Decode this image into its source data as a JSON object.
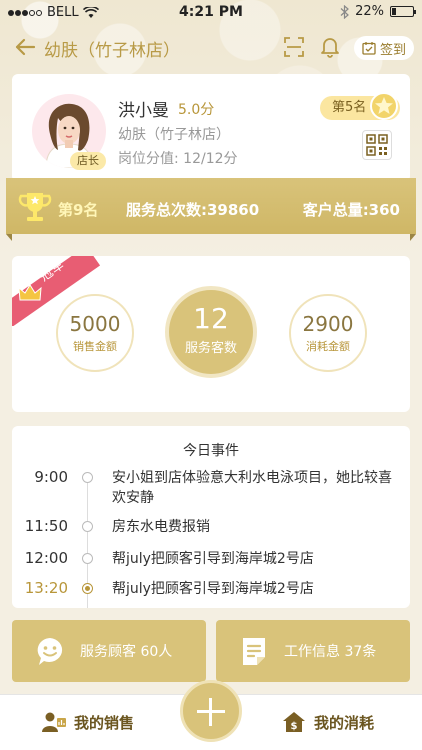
{
  "status_bar": {
    "carrier": "BELL",
    "time": "4:21 PM",
    "battery": "22%"
  },
  "nav": {
    "title": "幼肤（竹子林店）",
    "checkin_label": "签到"
  },
  "profile": {
    "name": "洪小曼",
    "score": "5.0分",
    "store": "幼肤（竹子林店）",
    "position_score": "岗位分值: 12/12分",
    "role": "店长",
    "rank": "第5名"
  },
  "ranking": {
    "rank": "第9名",
    "total_services": "服务总次数:39860",
    "total_customers": "客户总量:360"
  },
  "stats": {
    "badge": "冠军",
    "sales": {
      "value": "5000",
      "label": "销售金额"
    },
    "customers": {
      "value": "12",
      "label": "服务客数"
    },
    "consumption": {
      "value": "2900",
      "label": "消耗金额"
    }
  },
  "events": {
    "title": "今日事件",
    "items": [
      {
        "time": "9:00",
        "text": "安小姐到店体验意大利水电泳项目，她比较喜欢安静"
      },
      {
        "time": "11:50",
        "text": "房东水电费报销"
      },
      {
        "time": "12:00",
        "text": "帮july把顾客引导到海岸城2号店"
      },
      {
        "time": "13:20",
        "text": "帮july把顾客引导到海岸城2号店"
      }
    ]
  },
  "tiles": {
    "service": "服务顾客 60人",
    "work": "工作信息 37条"
  },
  "tabbar": {
    "sales": "我的销售",
    "consumption": "我的消耗"
  },
  "colors": {
    "gold": "#d9c37a",
    "accent_text": "#b8963a",
    "champion_red": "#e85d73"
  }
}
